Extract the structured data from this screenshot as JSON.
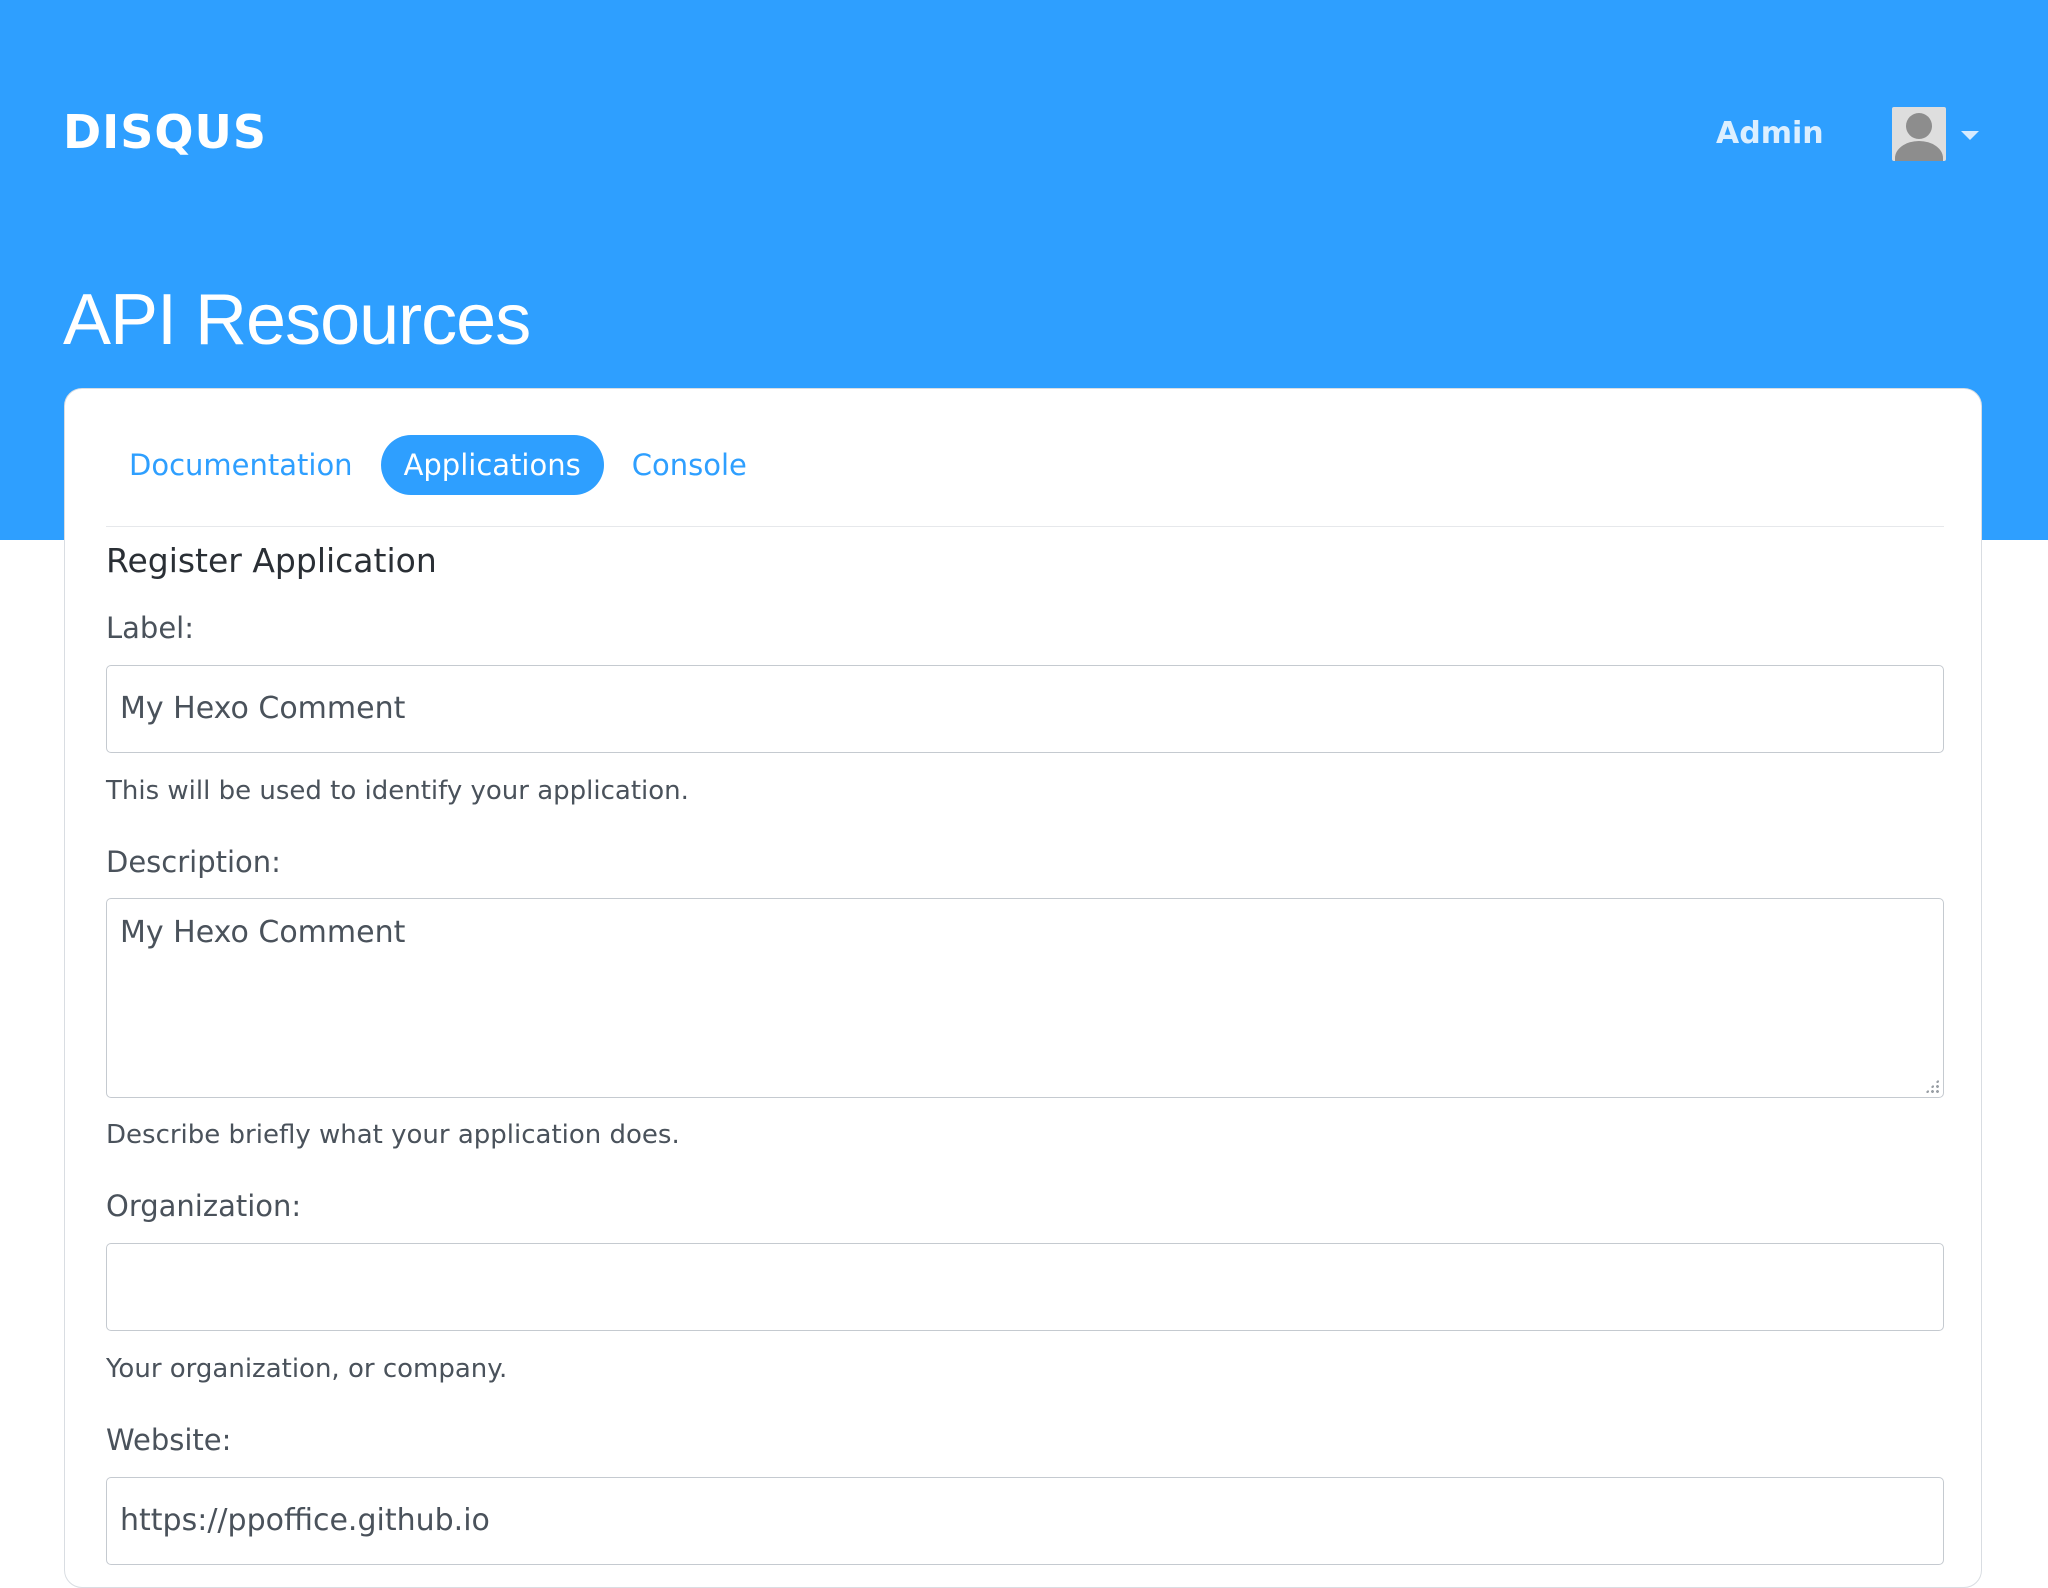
{
  "brand": {
    "logo_text": "DISQUS",
    "accent_color": "#2e9fff"
  },
  "header": {
    "admin_label": "Admin",
    "avatar_icon": "user-avatar-icon",
    "menu_icon": "caret-down-icon"
  },
  "page": {
    "title": "API Resources"
  },
  "tabs": [
    {
      "label": "Documentation",
      "active": false
    },
    {
      "label": "Applications",
      "active": true
    },
    {
      "label": "Console",
      "active": false
    }
  ],
  "form": {
    "section_title": "Register Application",
    "label_field": {
      "label": "Label:",
      "value": "My Hexo Comment",
      "help": "This will be used to identify your application."
    },
    "description_field": {
      "label": "Description:",
      "value": "My Hexo Comment",
      "help": "Describe briefly what your application does."
    },
    "organization_field": {
      "label": "Organization:",
      "value": "",
      "help": "Your organization, or company."
    },
    "website_field": {
      "label": "Website:",
      "value": "https://ppoffice.github.io"
    }
  }
}
